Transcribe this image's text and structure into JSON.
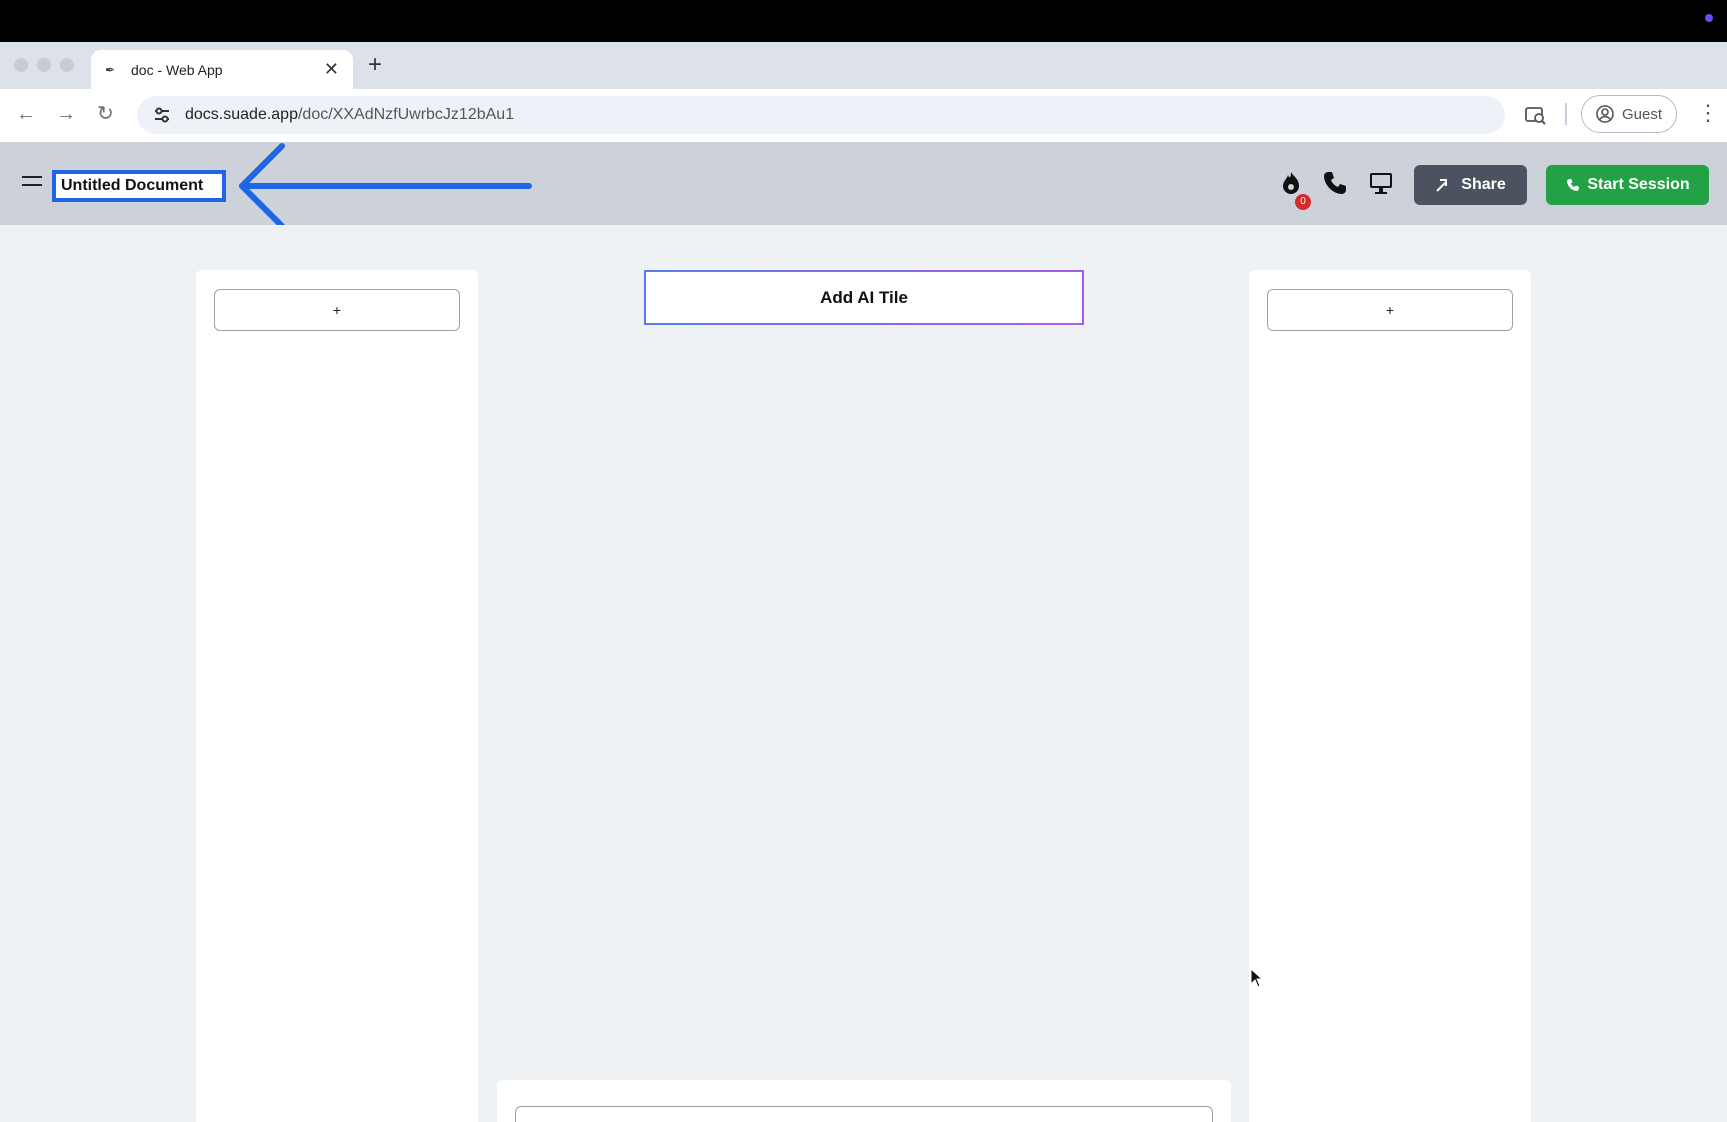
{
  "browser": {
    "tab_title": "doc - Web App",
    "new_tab_label": "+",
    "url_host": "docs.suade.app",
    "url_path": "/doc/XXAdNzfUwrbcJz12bAu1",
    "profile_label": "Guest"
  },
  "header": {
    "document_title": "Untitled Document",
    "notification_count": "0",
    "share_label": "Share",
    "start_session_label": "Start Session"
  },
  "canvas": {
    "left_add_label": "+",
    "right_add_label": "+",
    "ai_tile_label": "Add AI Tile"
  },
  "colors": {
    "highlight": "#1e66e5",
    "share_bg": "#4b5360",
    "session_bg": "#22a244",
    "badge": "#d42a2a"
  },
  "icons": [
    "back-arrow-icon",
    "forward-arrow-icon",
    "reload-icon",
    "site-settings-icon",
    "lens-icon",
    "profile-icon",
    "more-icon",
    "menu-icon",
    "fire-icon",
    "phone-icon",
    "monitor-icon",
    "share-icon"
  ]
}
